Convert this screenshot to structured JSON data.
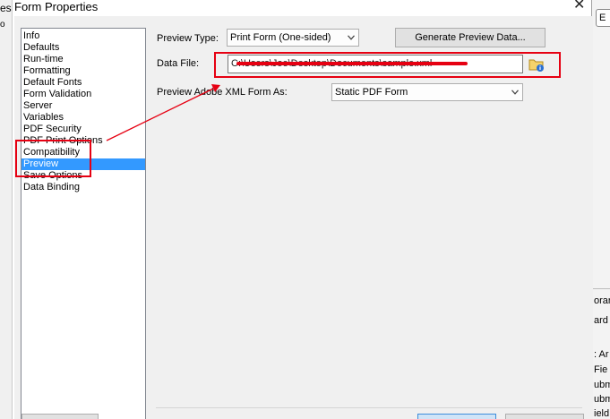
{
  "background_app": {
    "left_fragment": "es",
    "left_small_fragment": "o",
    "right_tab_fragment": "E",
    "right_fragments": [
      "oran",
      "ard",
      ": Ar",
      "Fie",
      "ubm",
      "ubm",
      "ield"
    ]
  },
  "dialog": {
    "title": "Form Properties",
    "close_glyph": "✕"
  },
  "categories": [
    {
      "label": "Info",
      "selected": false
    },
    {
      "label": "Defaults",
      "selected": false
    },
    {
      "label": "Run-time",
      "selected": false
    },
    {
      "label": "Formatting",
      "selected": false
    },
    {
      "label": "Default Fonts",
      "selected": false
    },
    {
      "label": "Form Validation",
      "selected": false
    },
    {
      "label": "Server",
      "selected": false
    },
    {
      "label": "Variables",
      "selected": false
    },
    {
      "label": "PDF Security",
      "selected": false
    },
    {
      "label": "PDF Print Options",
      "selected": false
    },
    {
      "label": "Compatibility",
      "selected": false
    },
    {
      "label": "Preview",
      "selected": true
    },
    {
      "label": "Save Options",
      "selected": false
    },
    {
      "label": "Data Binding",
      "selected": false
    }
  ],
  "preview": {
    "preview_type_label": "Preview Type:",
    "preview_type_value": "Print Form (One-sided)",
    "generate_button_label": "Generate Preview Data...",
    "data_file_label": "Data File:",
    "data_file_value": "C:\\Users\\Joe\\Desktop\\Documents\\sample.xml",
    "preview_as_label": "Preview Adobe XML Form As:",
    "preview_as_value": "Static PDF Form"
  },
  "icons": {
    "browse": "folder-info-icon",
    "dropdown": "chevron-down-icon",
    "close": "close-icon"
  },
  "colors": {
    "highlight": "#e60012",
    "selection": "#3399ff",
    "dialog_bg": "#f0f0f0"
  }
}
